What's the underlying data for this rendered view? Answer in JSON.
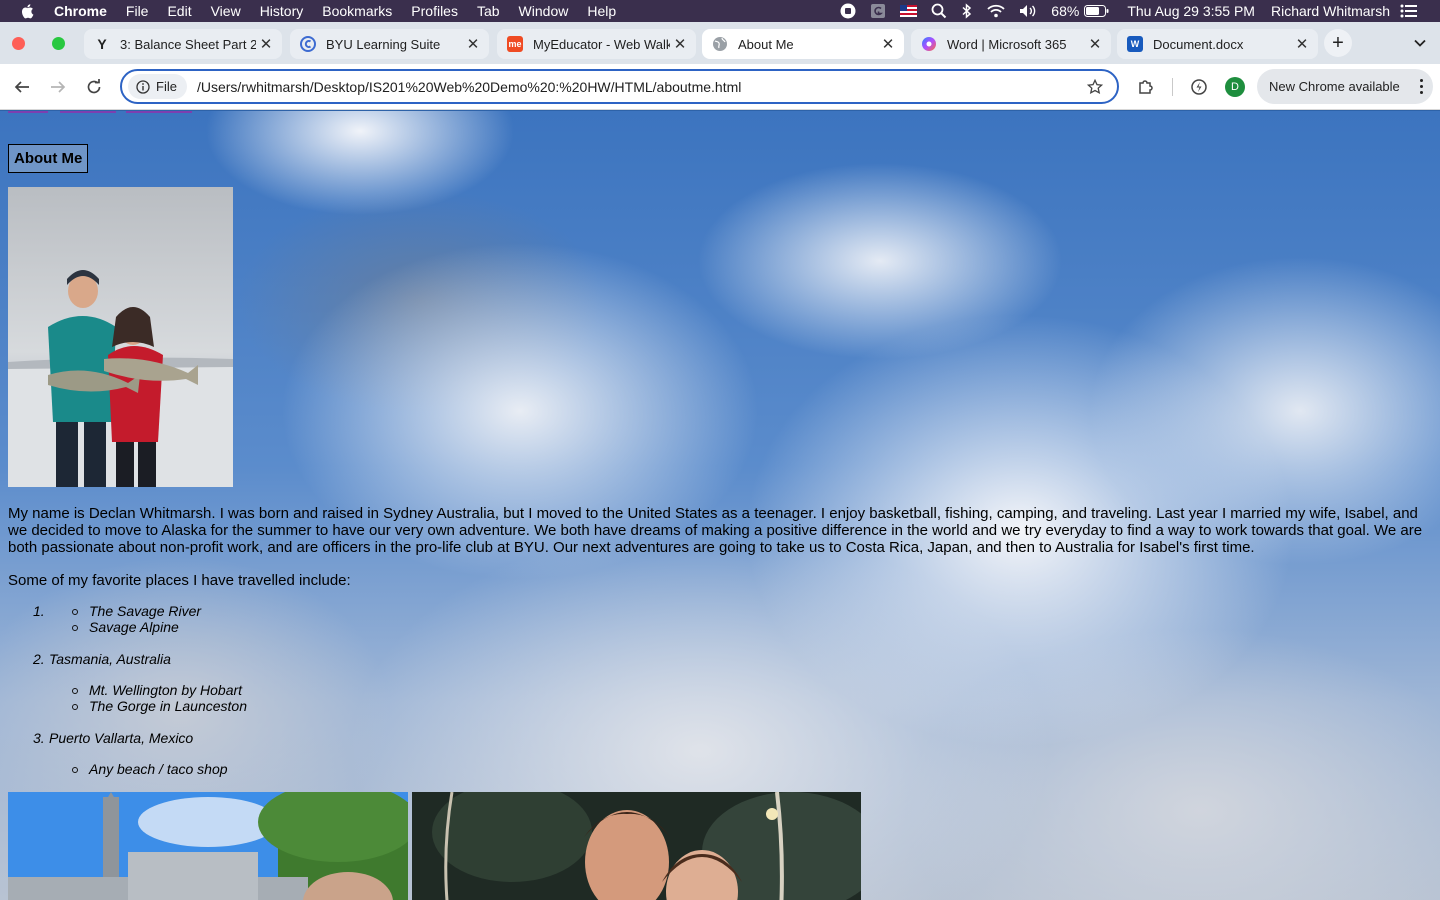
{
  "menubar": {
    "app_name": "Chrome",
    "items": [
      "File",
      "Edit",
      "View",
      "History",
      "Bookmarks",
      "Profiles",
      "Tab",
      "Window",
      "Help"
    ],
    "battery": "68%",
    "datetime": "Thu Aug 29  3:55 PM",
    "user": "Richard Whitmarsh"
  },
  "tabs": [
    {
      "title": "3: Balance Sheet Part 2",
      "favicon": "yahoo-icon",
      "active": false
    },
    {
      "title": "BYU Learning Suite",
      "favicon": "learning-suite-icon",
      "active": false
    },
    {
      "title": "MyEducator - Web Walk",
      "favicon": "myeducator-icon",
      "active": false
    },
    {
      "title": "About Me",
      "favicon": "globe-icon",
      "active": true
    },
    {
      "title": "Word | Microsoft 365",
      "favicon": "copilot-icon",
      "active": false
    },
    {
      "title": "Document.docx",
      "favicon": "word-icon",
      "active": false
    }
  ],
  "toolbar": {
    "chip_label": "File",
    "url": "/Users/rwhitmarsh/Desktop/IS201%20Web%20Demo%20:%20HW/HTML/aboutme.html",
    "profile_initial": "D",
    "update_label": "New Chrome available"
  },
  "page": {
    "heading": "About Me",
    "bio": "My name is Declan Whitmarsh. I was born and raised in Sydney Australia, but I moved to the United States as a teenager. I enjoy basketball, fishing, camping, and traveling. Last year I married my wife, Isabel, and we decided to move to Alaska for the summer to have our very own adventure. We both have dreams of making a positive difference in the world and we try everyday to find a way to work towards that goal. We are both passionate about non-profit work, and are officers in the pro-life club at BYU. Our next adventures are going to take us to Costa Rica, Japan, and then to Australia for Isabel's first time.",
    "places_intro": "Some of my favorite places I have travelled include:",
    "places": [
      {
        "number": "1.",
        "name": "",
        "subs": [
          "The Savage River",
          "Savage Alpine"
        ]
      },
      {
        "number": "2.",
        "name": "Tasmania, Australia",
        "subs": [
          "Mt. Wellington by Hobart",
          "The Gorge in Launceston"
        ]
      },
      {
        "number": "3.",
        "name": "Puerto Vallarta, Mexico",
        "subs": [
          "Any beach / taco shop"
        ]
      }
    ]
  }
}
